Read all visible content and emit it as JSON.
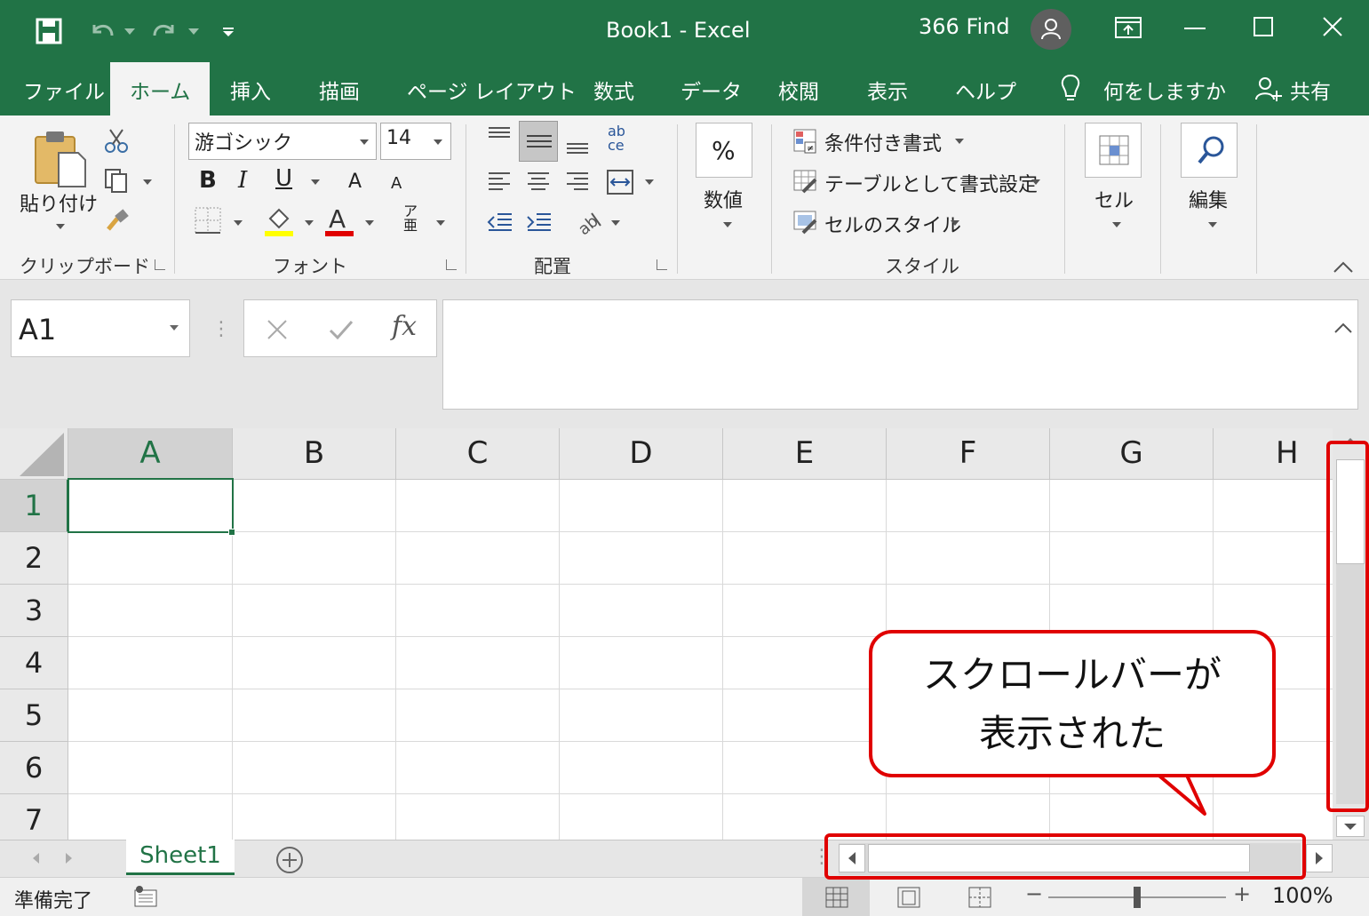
{
  "window": {
    "title": "Book1  -  Excel",
    "user_name": "366 Find"
  },
  "tabs": [
    "ファイル",
    "ホーム",
    "挿入",
    "描画",
    "ページ レイアウト",
    "数式",
    "データ",
    "校閲",
    "表示",
    "ヘルプ"
  ],
  "tell_me": "何をしますか",
  "share": "共有",
  "ribbon": {
    "clipboard": {
      "paste_label": "貼り付け",
      "group_label": "クリップボード"
    },
    "font": {
      "font_name": "游ゴシック",
      "font_size": "14",
      "group_label": "フォント"
    },
    "alignment": {
      "group_label": "配置"
    },
    "number": {
      "label": "数値",
      "icon": "%"
    },
    "styles": {
      "conditional": "条件付き書式",
      "table": "テーブルとして書式設定",
      "cell_styles": "セルのスタイル",
      "group_label": "スタイル"
    },
    "cells": {
      "label": "セル"
    },
    "editing": {
      "label": "編集"
    }
  },
  "formula_bar": {
    "name_box": "A1",
    "fx": "fx",
    "value": ""
  },
  "grid": {
    "columns": [
      "A",
      "B",
      "C",
      "D",
      "E",
      "F",
      "G",
      "H"
    ],
    "rows": [
      "1",
      "2",
      "3",
      "4",
      "5",
      "6",
      "7"
    ],
    "active_cell": "A1"
  },
  "sheets": [
    "Sheet1"
  ],
  "status": {
    "ready": "準備完了",
    "zoom": "100%"
  },
  "callout": {
    "line1": "スクロールバーが",
    "line2": "表示された"
  },
  "colors": {
    "accent": "#217346",
    "highlight": "#e00000"
  }
}
